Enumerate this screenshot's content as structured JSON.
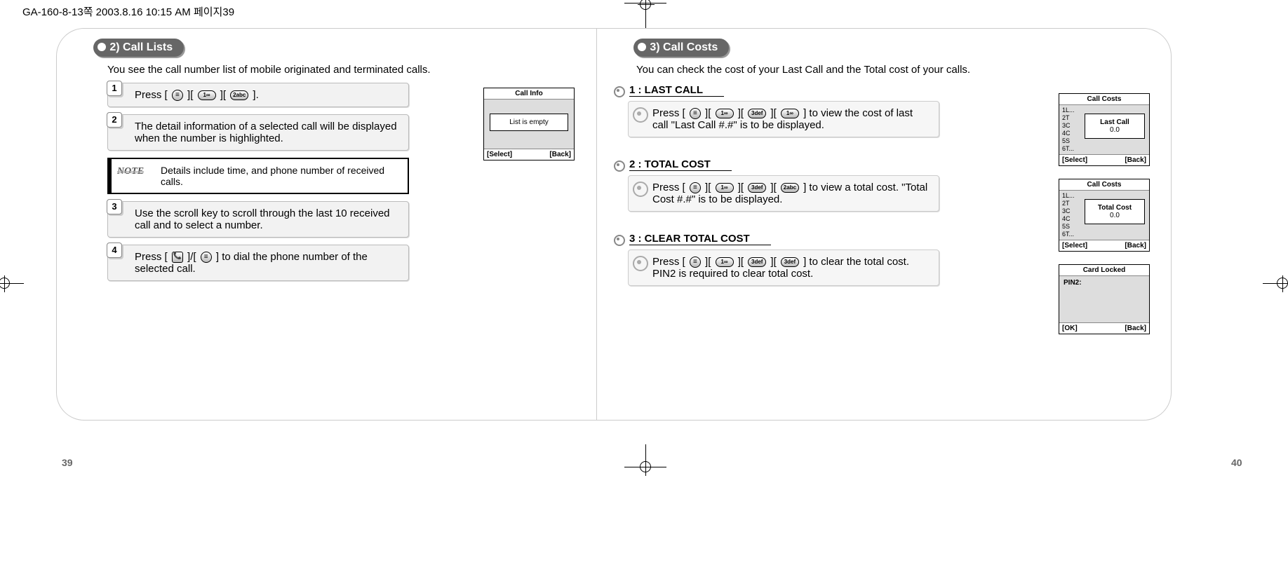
{
  "header": "GA-160-8-13쪽   2003.8.16 10:15 AM   페이지39",
  "page_numbers": {
    "left": "39",
    "right": "40"
  },
  "left": {
    "section_title": "2) Call Lists",
    "intro": "You see the call number list of  mobile originated and terminated calls.",
    "steps": [
      {
        "num": "1",
        "text_pre": "Press [ ",
        "text_mid1": " ][ ",
        "text_mid2": " ][ ",
        "text_post": " ]."
      },
      {
        "num": "2",
        "text": "The detail information of a selected call will be displayed when the number is highlighted."
      },
      {
        "num": "3",
        "text": "Use the scroll key to scroll through the last 10 received call and to select a number."
      },
      {
        "num": "4",
        "text_pre": "Press [ ",
        "text_mid": " ]/[ ",
        "text_post": " ] to dial the phone number of the selected call."
      }
    ],
    "note_label": "NOTE",
    "note_text": "Details include time, and phone number of received calls.",
    "phone": {
      "title": "Call Info",
      "body": "List is empty",
      "left_soft": "[Select]",
      "right_soft": "[Back]"
    }
  },
  "right": {
    "section_title": "3) Call Costs",
    "intro": "You can check the cost of your Last Call and the Total cost of your calls.",
    "sub1": {
      "heading": "1 : LAST CALL",
      "text_pre": "Press [ ",
      "text_mid1": " ][ ",
      "text_mid2": " ][ ",
      "text_mid3": " ][ ",
      "text_post": " ] to view the cost of last call \"Last Call #.#\" is to be displayed.",
      "phone": {
        "title": "Call Costs",
        "list": [
          "1L...",
          "2T",
          "3C",
          "4C",
          "5S",
          "6T..."
        ],
        "popup_title": "Last Call",
        "popup_value": "0.0",
        "left_soft": "[Select]",
        "right_soft": "[Back]"
      }
    },
    "sub2": {
      "heading": "2 : TOTAL COST",
      "text_pre": "Press [ ",
      "text_mid1": " ][ ",
      "text_mid2": " ][ ",
      "text_mid3": " ][ ",
      "text_post": " ] to view a total cost. \"Total Cost #.#\" is to be displayed.",
      "phone": {
        "title": "Call Costs",
        "list": [
          "1L...",
          "2T",
          "3C",
          "4C",
          "5S",
          "6T..."
        ],
        "popup_title": "Total Cost",
        "popup_value": "0.0",
        "left_soft": "[Select]",
        "right_soft": "[Back]"
      }
    },
    "sub3": {
      "heading": "3 : CLEAR TOTAL COST",
      "text_pre": "Press [ ",
      "text_mid1": " ][ ",
      "text_mid2": " ][ ",
      "text_mid3": " ][ ",
      "text_post": " ] to clear the total cost. PIN2 is required to clear total cost.",
      "phone": {
        "title": "Card Locked",
        "body_label": "PIN2:",
        "left_soft": "[OK]",
        "right_soft": "[Back]"
      }
    }
  }
}
